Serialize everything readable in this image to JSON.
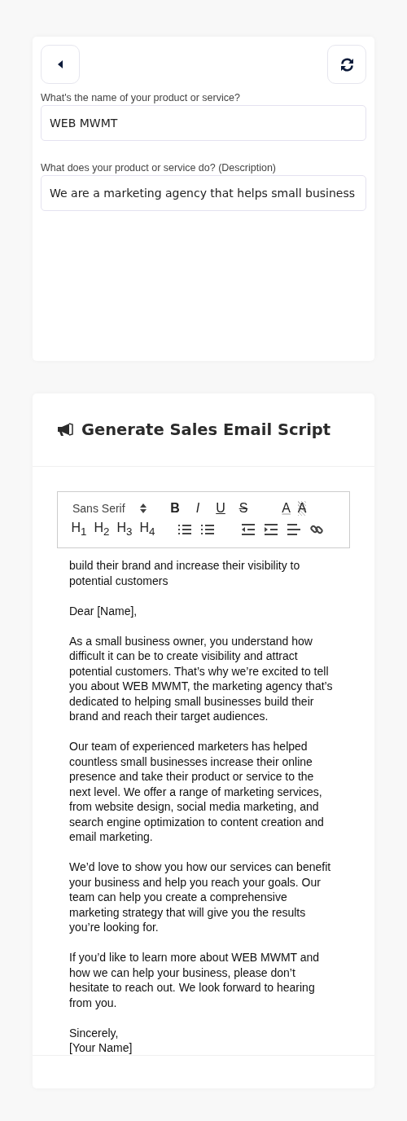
{
  "form": {
    "fields": [
      {
        "label": "What's the name of your product or service?",
        "value": "WEB MWMT"
      },
      {
        "label": "What does your product or service do? (Description)",
        "value": "We are a marketing agency that helps small business"
      }
    ]
  },
  "script": {
    "title": "Generate Sales Email Script",
    "toolbar": {
      "font": "Sans Serif",
      "rows": [
        [
          {
            "kind": "bold",
            "label": "B"
          },
          {
            "kind": "italic",
            "label": "I"
          },
          {
            "kind": "underline",
            "label": "U"
          },
          {
            "kind": "strike",
            "label": "S"
          },
          {
            "kind": "color",
            "label": "A"
          },
          {
            "kind": "background",
            "label": "A"
          }
        ],
        [
          {
            "kind": "header",
            "label": "H$_{1}$"
          },
          {
            "kind": "header",
            "label": "H$_{2}$"
          },
          {
            "kind": "header",
            "label": "H$_{3}$"
          },
          {
            "kind": "header",
            "label": "H$_{4}$"
          },
          {
            "kind": "ordered"
          },
          {
            "kind": "bullet"
          },
          {
            "kind": "outdent"
          },
          {
            "kind": "indent"
          },
          {
            "kind": "align"
          },
          {
            "kind": "link"
          }
        ]
      ]
    },
    "paragraphs": [
      "build their brand and increase their visibility to potential customers",
      "Dear [Name],",
      "As a small business owner, you understand how difficult it can be to create visibility and attract potential customers. That’s why we’re excited to tell you about WEB MWMT, the marketing agency that’s dedicated to helping small businesses build their brand and reach their target audiences.",
      "Our team of experienced marketers has helped countless small businesses increase their online presence and take their product or service to the next level. We offer a range of marketing services, from website design, social media marketing, and search engine optimization to content creation and email marketing.",
      "We’d love to show you how our services can benefit your business and help you reach your goals. Our team can help you create a comprehensive marketing strategy that will give you the results you’re looking for.",
      "If you’d like to learn more about WEB MWMT and how we can help your business, please don’t hesitate to reach out. We look forward to hearing from you.",
      "Sincerely,\n[Your Name]"
    ]
  }
}
